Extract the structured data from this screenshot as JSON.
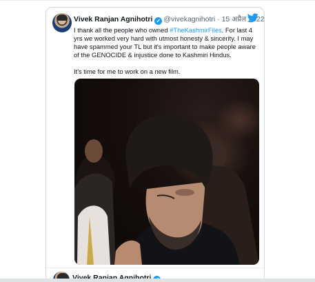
{
  "tweet": {
    "author_name": "Vivek Ranjan Agnihotri",
    "handle": "@vivekagnihotri",
    "separator": "·",
    "date": "15 अप्रैल 2022",
    "text_part1": "I thank all the people who owned ",
    "hashtag": "#TheKashmirFiles",
    "text_part2": ". For last 4 yrs we worked very hard with utmost honesty & sincerity. I may have spammed your TL but it's important to make people aware of the GENOCIDE & injustice done to Kashmiri Hindus.",
    "text_paragraph2": "It's time for me to work on a new film.",
    "verified_icon": "verified-badge-icon",
    "logo_icon": "twitter-bird-icon"
  },
  "next_tweet": {
    "author_name": "Vivek Ranjan Agnihotri"
  },
  "colors": {
    "accent": "#1d9bf0",
    "text": "#0f1419",
    "muted": "#536471",
    "border": "#cfd9de"
  }
}
